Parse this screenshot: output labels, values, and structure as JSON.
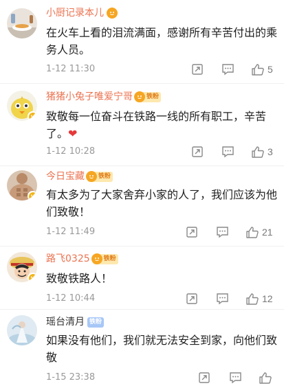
{
  "comments": [
    {
      "username": "小厨记录本儿",
      "badge": "",
      "text": "在火车上看的泪流满面，感谢所有辛苦付出的乘务人员。",
      "emoji": "",
      "time": "1-12 11:30",
      "likes": "5"
    },
    {
      "username": "猪猪小兔子唯爱宁哥",
      "badge": "铁粉",
      "text": "致敬每一位奋斗在铁路一线的所有职工，辛苦了。",
      "emoji": "❤",
      "time": "1-12 10:28",
      "likes": "3"
    },
    {
      "username": "今日宝藏",
      "badge": "铁粉",
      "text": "有太多为了大家舍弃小家的人了，我们应该为他们致敬！",
      "emoji": "",
      "time": "1-12 11:49",
      "likes": "21"
    },
    {
      "username": "路飞0325",
      "badge": "铁粉",
      "text": "致敬铁路人！",
      "emoji": "",
      "time": "1-12 10:44",
      "likes": "12"
    },
    {
      "username": "瑶台清月",
      "badge": "铁粉",
      "text": "如果没有他们，我们就无法安全到家，向他们致敬",
      "emoji": "",
      "time": "1-15 23:38",
      "likes": ""
    }
  ],
  "colors": {
    "username_highlight": "#eb7350",
    "username_plain": "#333333",
    "meta_gray": "#999999",
    "verified_badge": "#f2b518"
  },
  "icons": [
    "share-icon",
    "comment-icon",
    "like-icon",
    "verified-icon",
    "fan-badge-icon",
    "heart-emoji"
  ]
}
